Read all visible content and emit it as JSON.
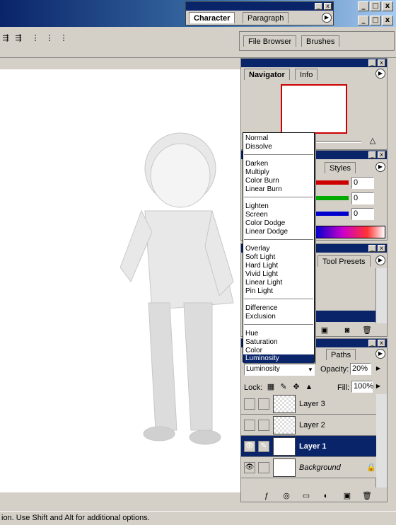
{
  "char_panel": {
    "tab_active": "Character",
    "tab_other": "Paragraph"
  },
  "window_buttons": [
    "_",
    "□",
    "x"
  ],
  "toolbar_icons": [
    "align-left-icon",
    "align-center-icon",
    "align-right-icon",
    "distribute-icon"
  ],
  "browser_tabs": [
    "File Browser",
    "Brushes"
  ],
  "navigator": {
    "tab_active": "Navigator",
    "tab_other": "Info"
  },
  "color_panel": {
    "tab_other": "Styles",
    "values": [
      "0",
      "0",
      "0"
    ],
    "colors": {
      "r": "#cc0000",
      "g": "#00aa00",
      "b": "#0000cc"
    }
  },
  "history_panel": {
    "tab_other": "Tool Presets"
  },
  "blend_menu": {
    "groups": [
      [
        "Normal",
        "Dissolve"
      ],
      [
        "Darken",
        "Multiply",
        "Color Burn",
        "Linear Burn"
      ],
      [
        "Lighten",
        "Screen",
        "Color Dodge",
        "Linear Dodge"
      ],
      [
        "Overlay",
        "Soft Light",
        "Hard Light",
        "Vivid Light",
        "Linear Light",
        "Pin Light"
      ],
      [
        "Difference",
        "Exclusion"
      ],
      [
        "Hue",
        "Saturation",
        "Color",
        "Luminosity"
      ]
    ],
    "selected": "Luminosity"
  },
  "layers_panel": {
    "tab_other": "Paths",
    "blend_mode": "Luminosity",
    "opacity_label": "Opacity:",
    "opacity_value": "20%",
    "lock_label": "Lock:",
    "fill_label": "Fill:",
    "fill_value": "100%",
    "layers": [
      {
        "name": "Layer 3",
        "visible": false,
        "selected": false
      },
      {
        "name": "Layer 2",
        "visible": false,
        "selected": false
      },
      {
        "name": "Layer 1",
        "visible": true,
        "selected": true
      },
      {
        "name": "Background",
        "visible": true,
        "selected": false
      }
    ]
  },
  "status": {
    "text": "ion.  Use Shift and Alt for additional options."
  }
}
